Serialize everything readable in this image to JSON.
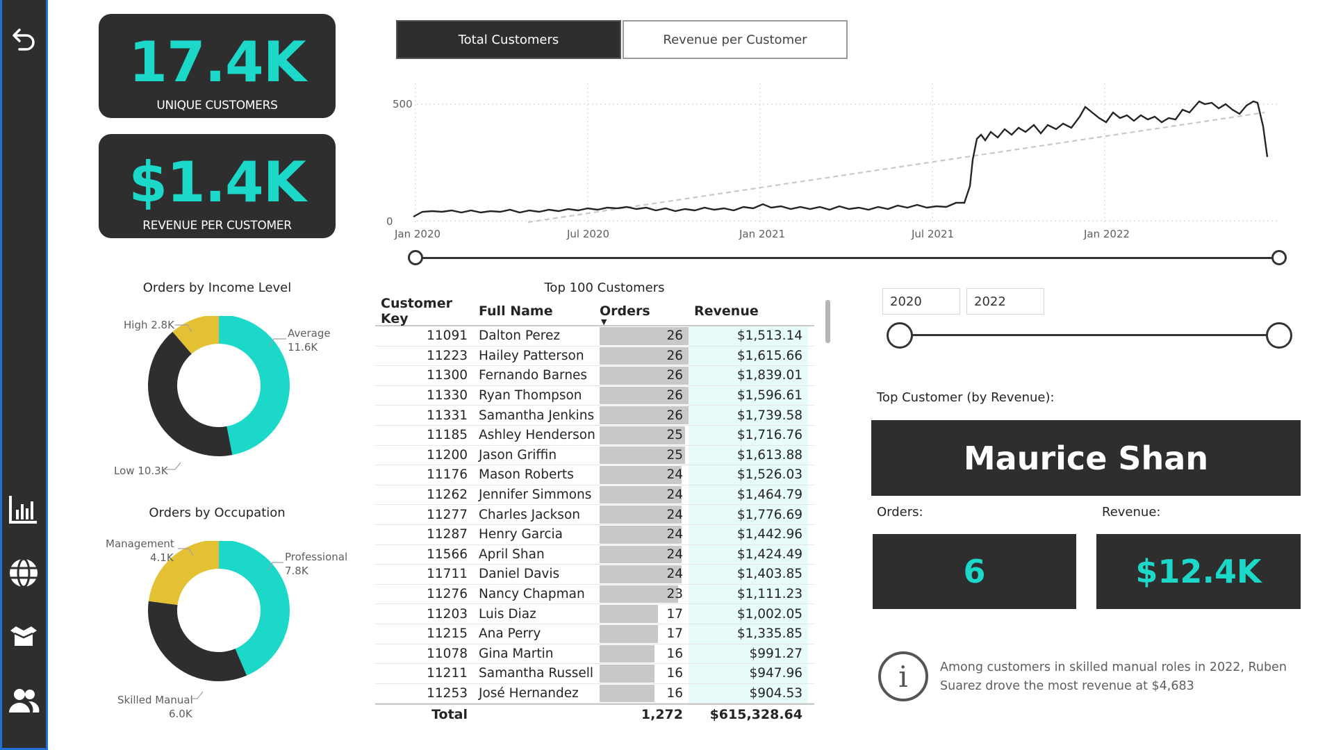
{
  "kpis": {
    "customers_value": "17.4K",
    "customers_label": "UNIQUE CUSTOMERS",
    "revenue_value": "$1.4K",
    "revenue_label": "REVENUE PER CUSTOMER"
  },
  "toggle": {
    "active_label": "Total Customers",
    "inactive_label": "Revenue per Customer"
  },
  "line_chart": {
    "y_ticks": [
      "500",
      "0"
    ],
    "x_ticks": [
      "Jan 2020",
      "Jul 2020",
      "Jan 2021",
      "Jul 2021",
      "Jan 2022"
    ]
  },
  "income_donut": {
    "title": "Orders by Income Level",
    "slices": [
      {
        "label": "Average",
        "value": "11.6K",
        "num": 11.6,
        "color": "#1bd8c9"
      },
      {
        "label": "Low",
        "value": "10.3K",
        "num": 10.3,
        "color": "#2e2e2e"
      },
      {
        "label": "High",
        "value": "2.8K",
        "num": 2.8,
        "color": "#e3c133"
      }
    ],
    "label_high": "High 2.8K",
    "label_avg_1": "Average",
    "label_avg_2": "11.6K",
    "label_low": "Low 10.3K"
  },
  "occupation_donut": {
    "title": "Orders by Occupation",
    "slices": [
      {
        "label": "Professional",
        "value": "7.8K",
        "num": 7.8,
        "color": "#1bd8c9"
      },
      {
        "label": "Skilled Manual",
        "value": "6.0K",
        "num": 6.0,
        "color": "#2e2e2e"
      },
      {
        "label": "Management",
        "value": "4.1K",
        "num": 4.1,
        "color": "#e3c133"
      }
    ],
    "label_mgmt_1": "Management",
    "label_mgmt_2": "4.1K",
    "label_prof_1": "Professional",
    "label_prof_2": "7.8K",
    "label_skill_1": "Skilled Manual",
    "label_skill_2": "6.0K"
  },
  "table": {
    "title": "Top 100 Customers",
    "headers": {
      "key": "Customer Key",
      "name": "Full Name",
      "orders": "Orders",
      "revenue": "Revenue"
    },
    "rows": [
      {
        "key": "11091",
        "name": "Dalton Perez",
        "orders": 26,
        "revenue": "$1,513.14"
      },
      {
        "key": "11223",
        "name": "Hailey Patterson",
        "orders": 26,
        "revenue": "$1,615.66"
      },
      {
        "key": "11300",
        "name": "Fernando Barnes",
        "orders": 26,
        "revenue": "$1,839.01"
      },
      {
        "key": "11330",
        "name": "Ryan Thompson",
        "orders": 26,
        "revenue": "$1,596.61"
      },
      {
        "key": "11331",
        "name": "Samantha Jenkins",
        "orders": 26,
        "revenue": "$1,739.58"
      },
      {
        "key": "11185",
        "name": "Ashley Henderson",
        "orders": 25,
        "revenue": "$1,716.76"
      },
      {
        "key": "11200",
        "name": "Jason Griffin",
        "orders": 25,
        "revenue": "$1,613.88"
      },
      {
        "key": "11176",
        "name": "Mason Roberts",
        "orders": 24,
        "revenue": "$1,526.03"
      },
      {
        "key": "11262",
        "name": "Jennifer Simmons",
        "orders": 24,
        "revenue": "$1,464.79"
      },
      {
        "key": "11277",
        "name": "Charles Jackson",
        "orders": 24,
        "revenue": "$1,776.69"
      },
      {
        "key": "11287",
        "name": "Henry Garcia",
        "orders": 24,
        "revenue": "$1,442.96"
      },
      {
        "key": "11566",
        "name": "April Shan",
        "orders": 24,
        "revenue": "$1,424.49"
      },
      {
        "key": "11711",
        "name": "Daniel Davis",
        "orders": 24,
        "revenue": "$1,403.85"
      },
      {
        "key": "11276",
        "name": "Nancy Chapman",
        "orders": 23,
        "revenue": "$1,111.23"
      },
      {
        "key": "11203",
        "name": "Luis Diaz",
        "orders": 17,
        "revenue": "$1,002.05"
      },
      {
        "key": "11215",
        "name": "Ana Perry",
        "orders": 17,
        "revenue": "$1,335.85"
      },
      {
        "key": "11078",
        "name": "Gina Martin",
        "orders": 16,
        "revenue": "$991.27"
      },
      {
        "key": "11211",
        "name": "Samantha Russell",
        "orders": 16,
        "revenue": "$947.96"
      },
      {
        "key": "11253",
        "name": "José Hernandez",
        "orders": 16,
        "revenue": "$904.53"
      }
    ],
    "total_label": "Total",
    "total_orders": "1,272",
    "total_revenue": "$615,328.64"
  },
  "year_filter": {
    "start": "2020",
    "end": "2022"
  },
  "top_customer": {
    "heading": "Top Customer (by Revenue):",
    "name": "Maurice Shan",
    "orders_label": "Orders:",
    "orders_value": "6",
    "revenue_label": "Revenue:",
    "revenue_value": "$12.4K"
  },
  "insight": {
    "line1": "Among customers in skilled manual roles in 2022, Ruben",
    "line2": "Suarez drove the most revenue at $4,683"
  },
  "colors": {
    "teal": "#1bd8c9",
    "dark": "#2e2e2e",
    "gold": "#e3c133",
    "sidebar_border": "#1f6fd6"
  },
  "icons": [
    "back-arrow-icon",
    "bar-chart-icon",
    "globe-icon",
    "box-icon",
    "users-icon",
    "info-icon"
  ]
}
